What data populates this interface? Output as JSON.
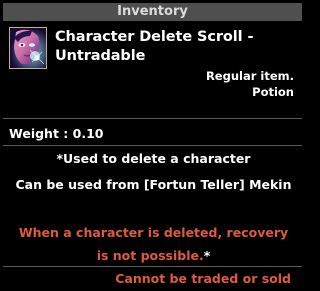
{
  "window": {
    "title": "Inventory"
  },
  "item": {
    "icon": "scroll-portrait-icon",
    "name_line1": "Character Delete Scroll -",
    "name_line2": "Untradable",
    "type_line1": "Regular item.",
    "type_line2": "Potion",
    "weight": "Weight : 0.10",
    "description_line1": "*Used to delete a character",
    "description_line2": "Can be used from [Fortun Teller] Mekin",
    "warning_line1": "When a character is deleted, recovery",
    "warning_line2": "is not possible.",
    "warning_mark": "*",
    "trade_note": "Cannot be traded or sold"
  },
  "colors": {
    "title_bar": "#4f4f4f",
    "warning_text": "#e05a3c",
    "icon_border": "#c9b27a",
    "background": "#000000"
  }
}
